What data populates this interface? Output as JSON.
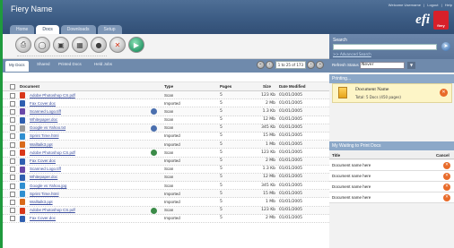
{
  "header": {
    "app_title": "Fiery Name",
    "tabs": [
      "Home",
      "Docs",
      "Downloads",
      "Setup"
    ],
    "top_links": [
      "Welcome Username",
      "|",
      "Logout",
      "|",
      "Help"
    ],
    "logo_text": "efi",
    "logo_badge": "fiery"
  },
  "toolbar": {
    "buttons": [
      "print-icon",
      "preview-icon",
      "save-icon",
      "archive-icon",
      "user-icon",
      "delete-icon",
      "go-icon"
    ]
  },
  "subtabs": [
    "My Docs",
    "Shared",
    "Printed Docs",
    "Held Jobs"
  ],
  "pager": {
    "text": "1 to 25 of 173"
  },
  "table": {
    "headers": {
      "document": "Document",
      "type": "Type",
      "pages": "Pages",
      "size": "Size",
      "date": "Date Modified"
    },
    "rows": [
      {
        "name": "Adobe Photoshop CS.pdf",
        "type": "Scan",
        "pages": "5",
        "size": "123 Kb",
        "date": "01/01/2005",
        "icon": "#d9371a",
        "status": ""
      },
      {
        "name": "Fax Cover.doc",
        "type": "Imported",
        "pages": "5",
        "size": "2 Mb",
        "date": "01/01/2005",
        "icon": "#2f5fb0",
        "status": ""
      },
      {
        "name": "Scanned Logo.tiff",
        "type": "Scan",
        "pages": "5",
        "size": "1.3 Kb",
        "date": "01/01/2005",
        "icon": "#6a48a8",
        "status": "#4a6fae"
      },
      {
        "name": "Whitepaper.doc",
        "type": "Scan",
        "pages": "5",
        "size": "12 Mb",
        "date": "01/01/2005",
        "icon": "#2f5fb0",
        "status": ""
      },
      {
        "name": "Google vs Yahoo.txt",
        "type": "Scan",
        "pages": "5",
        "size": "345 Kb",
        "date": "01/01/2005",
        "icon": "#9a9a9a",
        "status": "#4a6fae"
      },
      {
        "name": "Sprint Time.html",
        "type": "Imported",
        "pages": "5",
        "size": "15 Mb",
        "date": "01/01/2005",
        "icon": "#2f8fd0",
        "status": ""
      },
      {
        "name": "Walltalk3.ppt",
        "type": "Imported",
        "pages": "5",
        "size": "1 Mb",
        "date": "01/01/2005",
        "icon": "#d96a1a",
        "status": ""
      },
      {
        "name": "Adobe Photoshop CS.pdf",
        "type": "Scan",
        "pages": "5",
        "size": "123 Kb",
        "date": "01/01/2005",
        "icon": "#d9371a",
        "status": "#3b8b48"
      },
      {
        "name": "Fax Cover.doc",
        "type": "Imported",
        "pages": "5",
        "size": "2 Mb",
        "date": "01/01/2005",
        "icon": "#2f5fb0",
        "status": ""
      },
      {
        "name": "Scanned Logo.tiff",
        "type": "Scan",
        "pages": "5",
        "size": "1.3 Kb",
        "date": "01/01/2005",
        "icon": "#6a48a8",
        "status": ""
      },
      {
        "name": "Whitepaper.doc",
        "type": "Scan",
        "pages": "5",
        "size": "12 Mb",
        "date": "01/01/2005",
        "icon": "#2f5fb0",
        "status": ""
      },
      {
        "name": "Google vs Yahoo.jpg",
        "type": "Scan",
        "pages": "5",
        "size": "345 Kb",
        "date": "01/01/2005",
        "icon": "#2f8fd0",
        "status": ""
      },
      {
        "name": "Sprint Time.html",
        "type": "Imported",
        "pages": "5",
        "size": "15 Mb",
        "date": "01/01/2005",
        "icon": "#2f8fd0",
        "status": ""
      },
      {
        "name": "Walltalk3.ppt",
        "type": "Imported",
        "pages": "5",
        "size": "1 Mb",
        "date": "01/01/2005",
        "icon": "#d96a1a",
        "status": ""
      },
      {
        "name": "Adobe Photoshop CS.pdf",
        "type": "Scan",
        "pages": "5",
        "size": "123 Kb",
        "date": "01/01/2005",
        "icon": "#d9371a",
        "status": "#3b8b48"
      },
      {
        "name": "Fax Cover.doc",
        "type": "Imported",
        "pages": "5",
        "size": "2 Mb",
        "date": "01/01/2005",
        "icon": "#2f5fb0",
        "status": ""
      }
    ]
  },
  "right": {
    "search_label": "Search",
    "advanced_search": ">> Advanced Search",
    "refresh_label": "Refresh Status",
    "refresh_value": "Never",
    "printing_head": "Printing...",
    "printing_doc": "Document Name",
    "printing_total": "Total: 5 Docs (450 pages)",
    "waiting_head": "My Waiting to Print Docs",
    "waiting_cols": {
      "title": "Title",
      "cancel": "Cancel"
    },
    "waiting_rows": [
      "Document name here",
      "Document name here",
      "Document name here",
      "Document name here"
    ]
  }
}
